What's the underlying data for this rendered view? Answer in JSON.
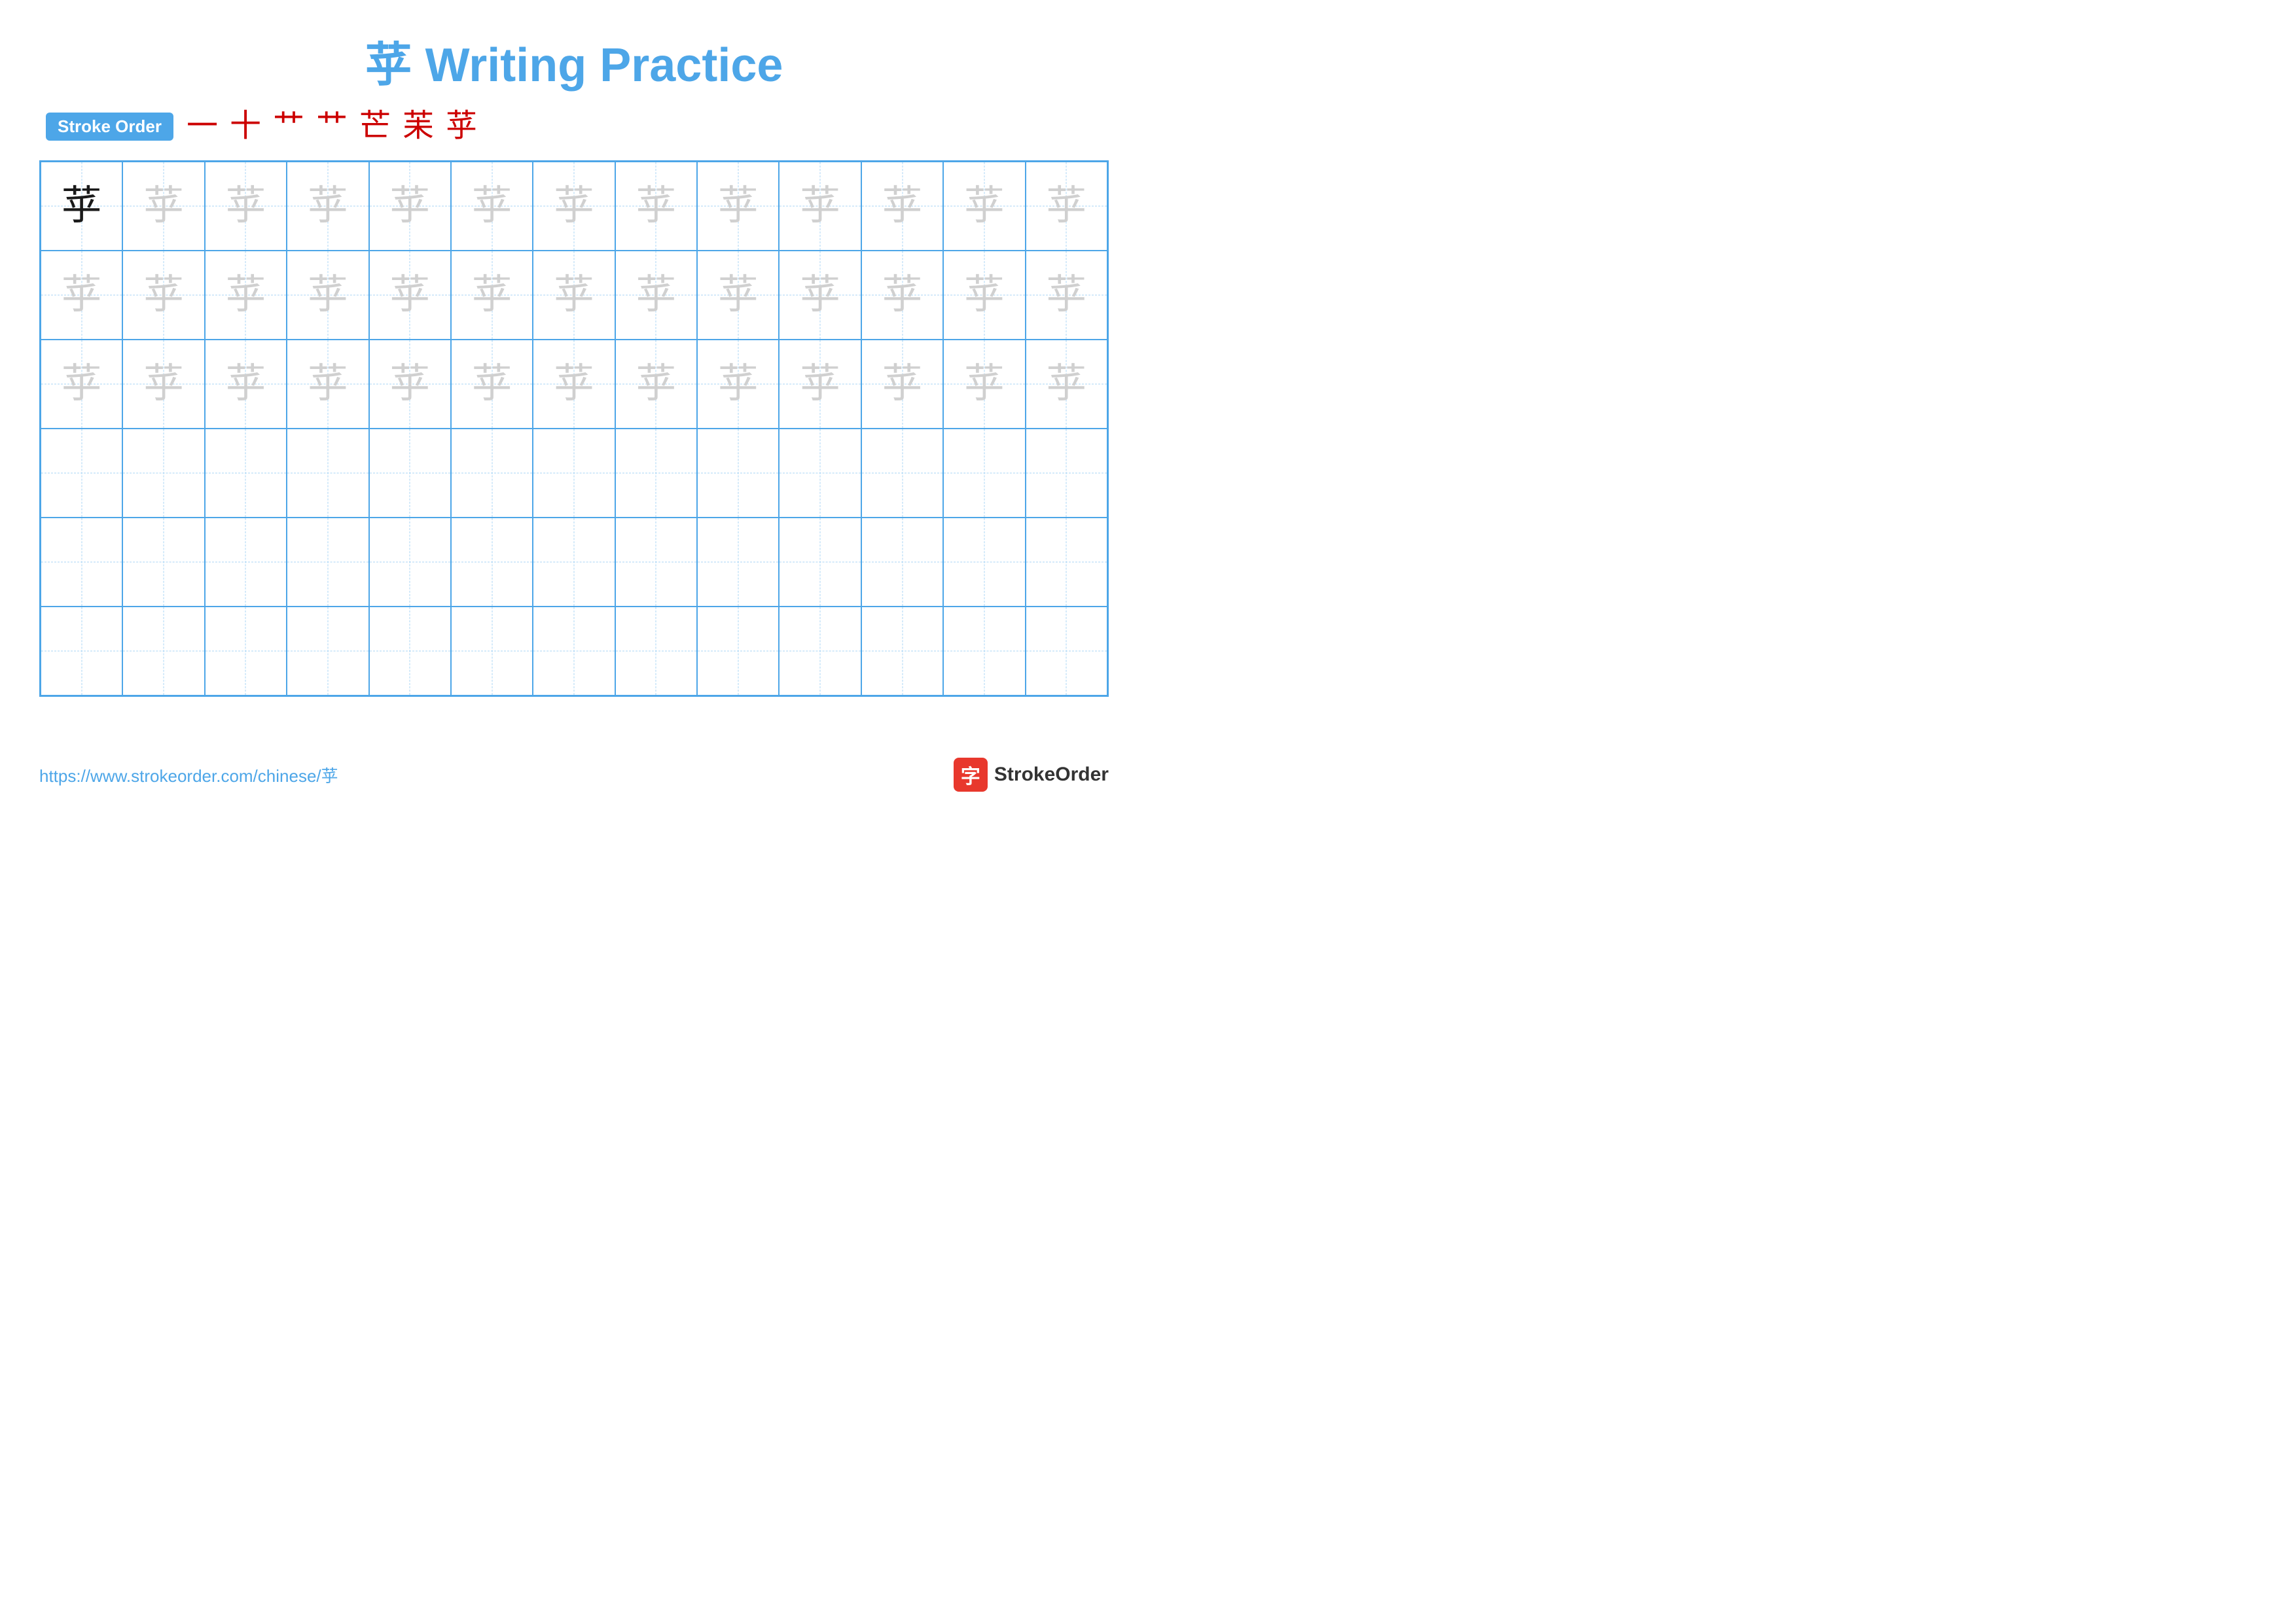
{
  "title": "苸 Writing Practice",
  "stroke_order_label": "Stroke Order",
  "stroke_sequence": [
    "一",
    "十",
    "艹",
    "艹",
    "芒",
    "苿",
    "苸"
  ],
  "character": "苸",
  "url": "https://www.strokeorder.com/chinese/苸",
  "logo_char": "字",
  "logo_name": "StrokeOrder",
  "grid": {
    "rows": 6,
    "cols": 13,
    "row1_first_dark": true,
    "char_light": "苸",
    "char_dark": "苸"
  }
}
